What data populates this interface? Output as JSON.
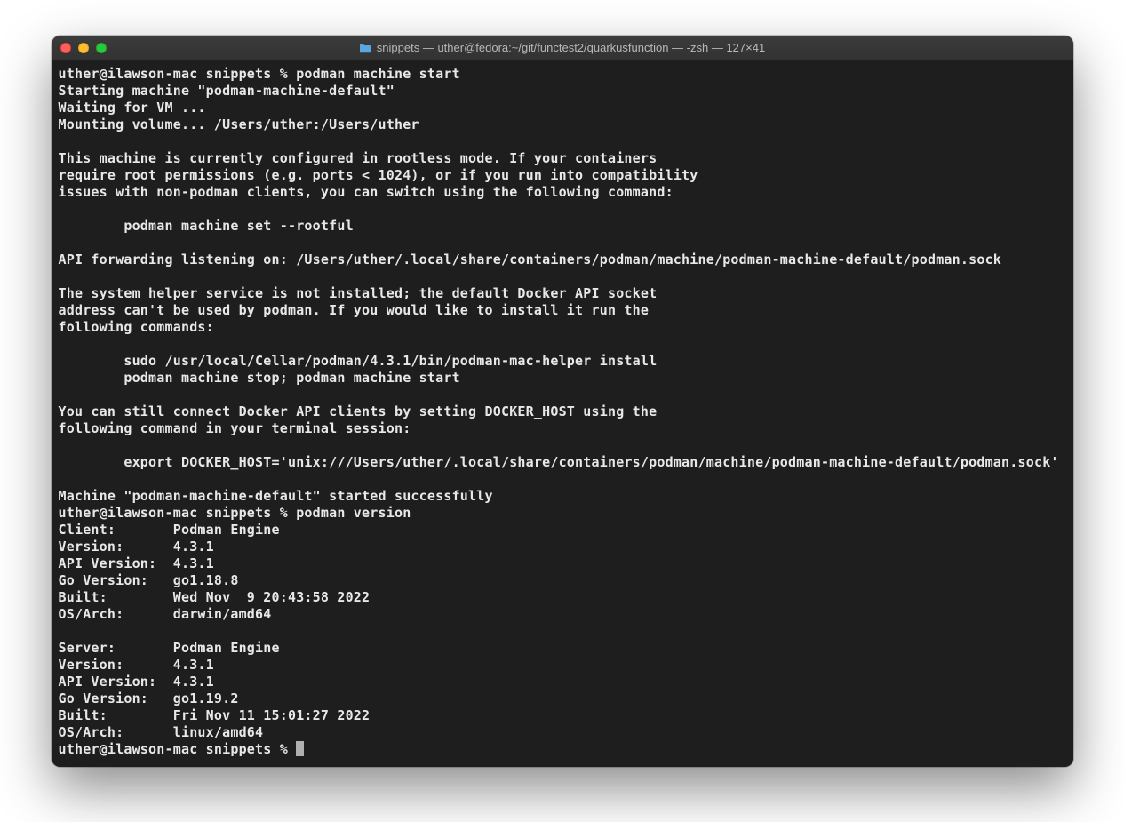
{
  "window": {
    "title": "snippets — uther@fedora:~/git/functest2/quarkusfunction — -zsh — 127×41"
  },
  "terminal": {
    "lines": [
      "uther@ilawson-mac snippets % podman machine start",
      "Starting machine \"podman-machine-default\"",
      "Waiting for VM ...",
      "Mounting volume... /Users/uther:/Users/uther",
      "",
      "This machine is currently configured in rootless mode. If your containers",
      "require root permissions (e.g. ports < 1024), or if you run into compatibility",
      "issues with non-podman clients, you can switch using the following command:",
      "",
      "        podman machine set --rootful",
      "",
      "API forwarding listening on: /Users/uther/.local/share/containers/podman/machine/podman-machine-default/podman.sock",
      "",
      "The system helper service is not installed; the default Docker API socket",
      "address can't be used by podman. If you would like to install it run the",
      "following commands:",
      "",
      "        sudo /usr/local/Cellar/podman/4.3.1/bin/podman-mac-helper install",
      "        podman machine stop; podman machine start",
      "",
      "You can still connect Docker API clients by setting DOCKER_HOST using the",
      "following command in your terminal session:",
      "",
      "        export DOCKER_HOST='unix:///Users/uther/.local/share/containers/podman/machine/podman-machine-default/podman.sock'",
      "",
      "Machine \"podman-machine-default\" started successfully",
      "uther@ilawson-mac snippets % podman version",
      "Client:       Podman Engine",
      "Version:      4.3.1",
      "API Version:  4.3.1",
      "Go Version:   go1.18.8",
      "Built:        Wed Nov  9 20:43:58 2022",
      "OS/Arch:      darwin/amd64",
      "",
      "Server:       Podman Engine",
      "Version:      4.3.1",
      "API Version:  4.3.1",
      "Go Version:   go1.19.2",
      "Built:        Fri Nov 11 15:01:27 2022",
      "OS/Arch:      linux/amd64"
    ],
    "prompt": "uther@ilawson-mac snippets % "
  }
}
